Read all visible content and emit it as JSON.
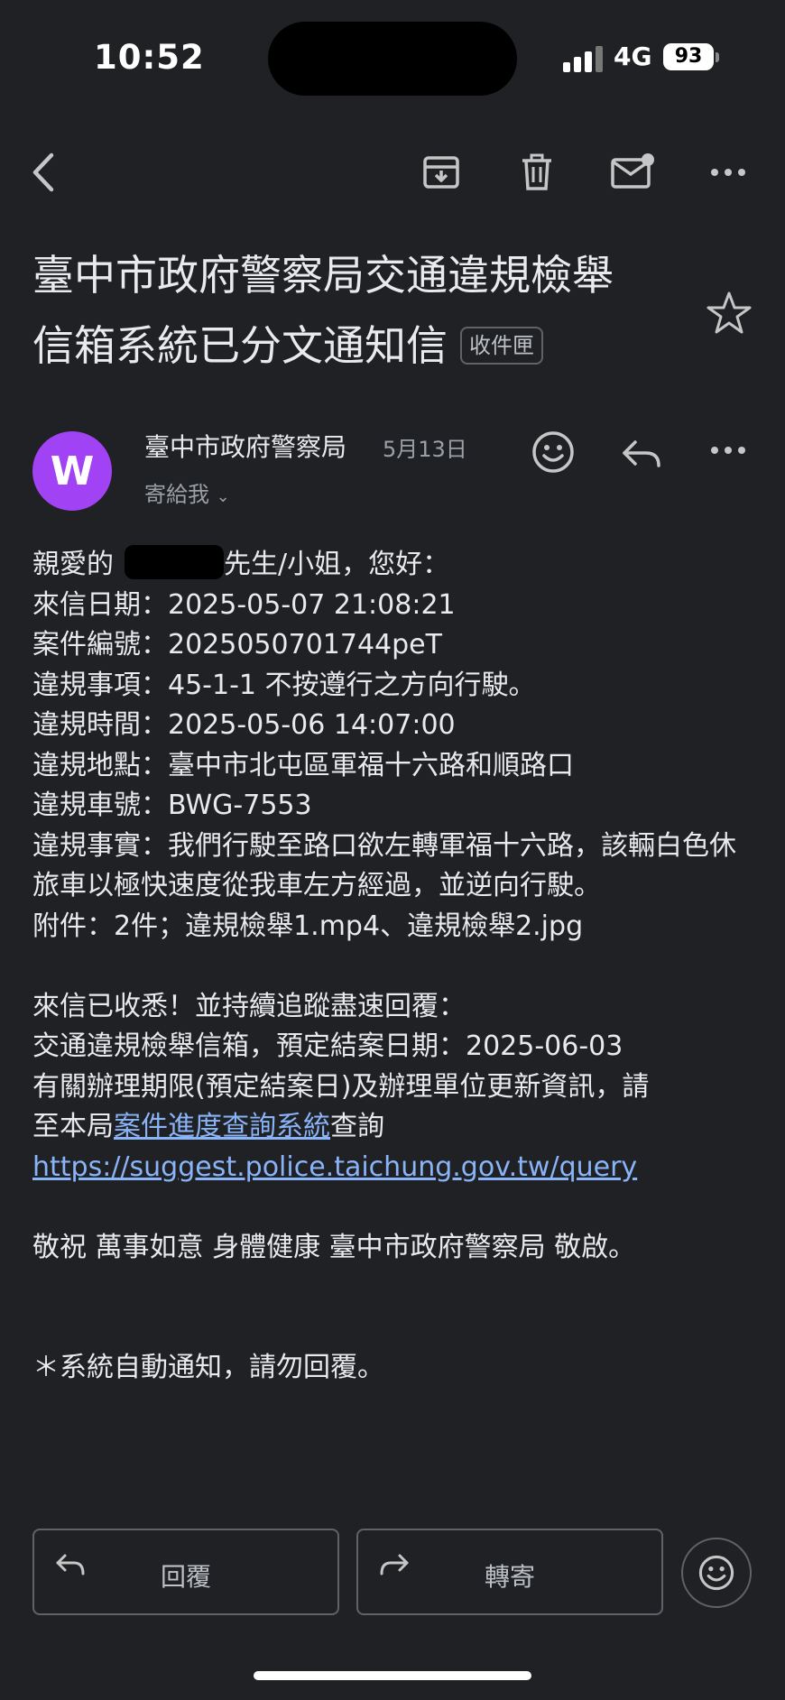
{
  "status_bar": {
    "time": "10:52",
    "network": "4G",
    "battery": "93"
  },
  "toolbar": {
    "icons": [
      "back-icon",
      "archive-icon",
      "delete-icon",
      "mark-unread-icon",
      "more-icon"
    ]
  },
  "email": {
    "subject_line1": "臺中市政府警察局交通違規檢舉",
    "subject_line2": "信箱系統已分文通知信",
    "label": "收件匣",
    "sender": {
      "avatar_letter": "W",
      "name": "臺中市政府警察局",
      "date": "5月13日",
      "to": "寄給我",
      "avatar_color": "#a142f4"
    },
    "body": {
      "greeting_prefix": "親愛的",
      "greeting_suffix": "先生/小姐，您好：",
      "lines": [
        "來信日期：2025-05-07 21:08:21",
        "案件編號：2025050701744peT",
        "違規事項：45-1-1 不按遵行之方向行駛。",
        "違規時間：2025-05-06 14:07:00",
        "違規地點：臺中市北屯區軍福十六路和順路口",
        "違規車號：BWG-7553",
        "違規事實：我們行駛至路口欲左轉軍福十六路，該輛白色休旅車以極快速度從我車左方經過，並逆向行駛。",
        "附件：2件；違規檢舉1.mp4、違規檢舉2.jpg"
      ],
      "received_line": "來信已收悉！並持續追蹤盡速回覆：",
      "due_line": "交通違規檢舉信箱，預定結案日期：2025-06-03",
      "update_line": "有關辦理期限(預定結案日)及辦理單位更新資訊，請",
      "query_prefix": "至本局",
      "query_link": "案件進度查詢系統",
      "query_suffix": "查詢",
      "url": "https://suggest.police.taichung.gov.tw/query",
      "closing": "敬祝 萬事如意 身體健康 臺中市政府警察局 敬啟。",
      "notice": "＊系統自動通知，請勿回覆。"
    }
  },
  "actions": {
    "reply": "回覆",
    "forward": "轉寄"
  },
  "colors": {
    "background": "#202124",
    "link": "#8ab4f8",
    "text": "#e8eaed",
    "muted": "#9aa0a6"
  }
}
